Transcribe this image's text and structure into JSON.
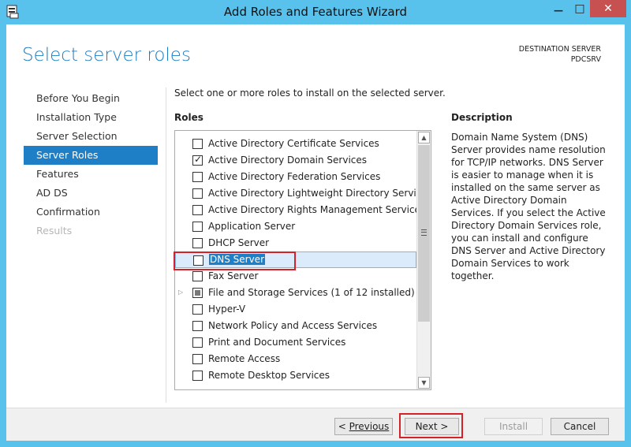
{
  "window": {
    "title": "Add Roles and Features Wizard",
    "min_glyph": "—",
    "max_glyph": "□",
    "close_glyph": "✕"
  },
  "header": {
    "page_title": "Select server roles",
    "destination_label": "DESTINATION SERVER",
    "destination_server": "PDCSRV"
  },
  "nav": {
    "items": [
      {
        "label": "Before You Begin",
        "state": "normal"
      },
      {
        "label": "Installation Type",
        "state": "normal"
      },
      {
        "label": "Server Selection",
        "state": "normal"
      },
      {
        "label": "Server Roles",
        "state": "active"
      },
      {
        "label": "Features",
        "state": "normal"
      },
      {
        "label": "AD DS",
        "state": "normal"
      },
      {
        "label": "Confirmation",
        "state": "normal"
      },
      {
        "label": "Results",
        "state": "disabled"
      }
    ]
  },
  "main": {
    "instruction": "Select one or more roles to install on the selected server.",
    "roles_label": "Roles",
    "roles": [
      {
        "label": "Active Directory Certificate Services",
        "state": "unchecked"
      },
      {
        "label": "Active Directory Domain Services",
        "state": "checked"
      },
      {
        "label": "Active Directory Federation Services",
        "state": "unchecked"
      },
      {
        "label": "Active Directory Lightweight Directory Services",
        "state": "unchecked"
      },
      {
        "label": "Active Directory Rights Management Services",
        "state": "unchecked"
      },
      {
        "label": "Application Server",
        "state": "unchecked"
      },
      {
        "label": "DHCP Server",
        "state": "unchecked"
      },
      {
        "label": "DNS Server",
        "state": "unchecked",
        "selected": true
      },
      {
        "label": "Fax Server",
        "state": "unchecked"
      },
      {
        "label": "File and Storage Services (1 of 12 installed)",
        "state": "partial",
        "expandable": true
      },
      {
        "label": "Hyper-V",
        "state": "unchecked"
      },
      {
        "label": "Network Policy and Access Services",
        "state": "unchecked"
      },
      {
        "label": "Print and Document Services",
        "state": "unchecked"
      },
      {
        "label": "Remote Access",
        "state": "unchecked"
      },
      {
        "label": "Remote Desktop Services",
        "state": "unchecked"
      }
    ],
    "description_label": "Description",
    "description_text": "Domain Name System (DNS) Server provides name resolution for TCP/IP networks. DNS Server is easier to manage when it is installed on the same server as Active Directory Domain Services. If you select the Active Directory Domain Services role, you can install and configure DNS Server and Active Directory Domain Services to work together."
  },
  "footer": {
    "previous_prefix": "< ",
    "previous_label": "Previous",
    "next_label": "Next >",
    "install_label": "Install",
    "cancel_label": "Cancel"
  },
  "colors": {
    "accent": "#1e7fc7",
    "title_bar": "#58c1ec",
    "highlight_red": "#d3222a",
    "page_title": "#1a7cc1"
  }
}
